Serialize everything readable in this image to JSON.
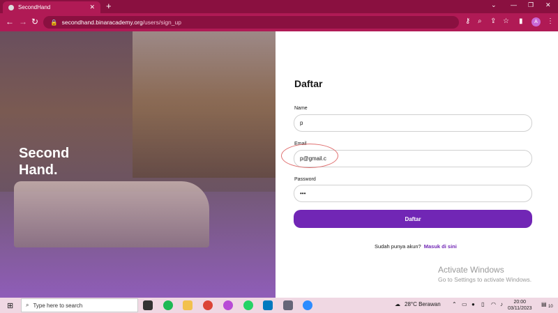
{
  "browser": {
    "tab_title": "SecondHand",
    "new_tab": "+",
    "url_host": "secondhand.binaracademy.org",
    "url_path": "/users/sign_up",
    "profile_initial": "A"
  },
  "hero": {
    "brand_line1": "Second",
    "brand_line2": "Hand."
  },
  "form": {
    "title": "Daftar",
    "name_label": "Name",
    "name_value": "p",
    "email_label": "Email",
    "email_value": "p@gmail.c",
    "password_label": "Password",
    "password_value": "•••",
    "submit_label": "Daftar",
    "login_prompt": "Sudah punya akun?",
    "login_link": "Masuk di sini"
  },
  "watermark": {
    "line1": "Activate Windows",
    "line2": "Go to Settings to activate Windows."
  },
  "taskbar": {
    "search_placeholder": "Type here to search",
    "weather": "28°C  Berawan",
    "time": "20:00",
    "date": "03/11/2023",
    "notifications": "10"
  },
  "colors": {
    "accent": "#7126b5",
    "chrome": "#b01a55",
    "chrome_dark": "#8a1040"
  },
  "icons": [
    "search-icon",
    "key-icon",
    "zoom-icon",
    "share-icon",
    "star-icon",
    "sidebar-icon",
    "menu-icon",
    "back-icon",
    "forward-icon",
    "reload-icon",
    "lock-icon",
    "windows-icon"
  ]
}
